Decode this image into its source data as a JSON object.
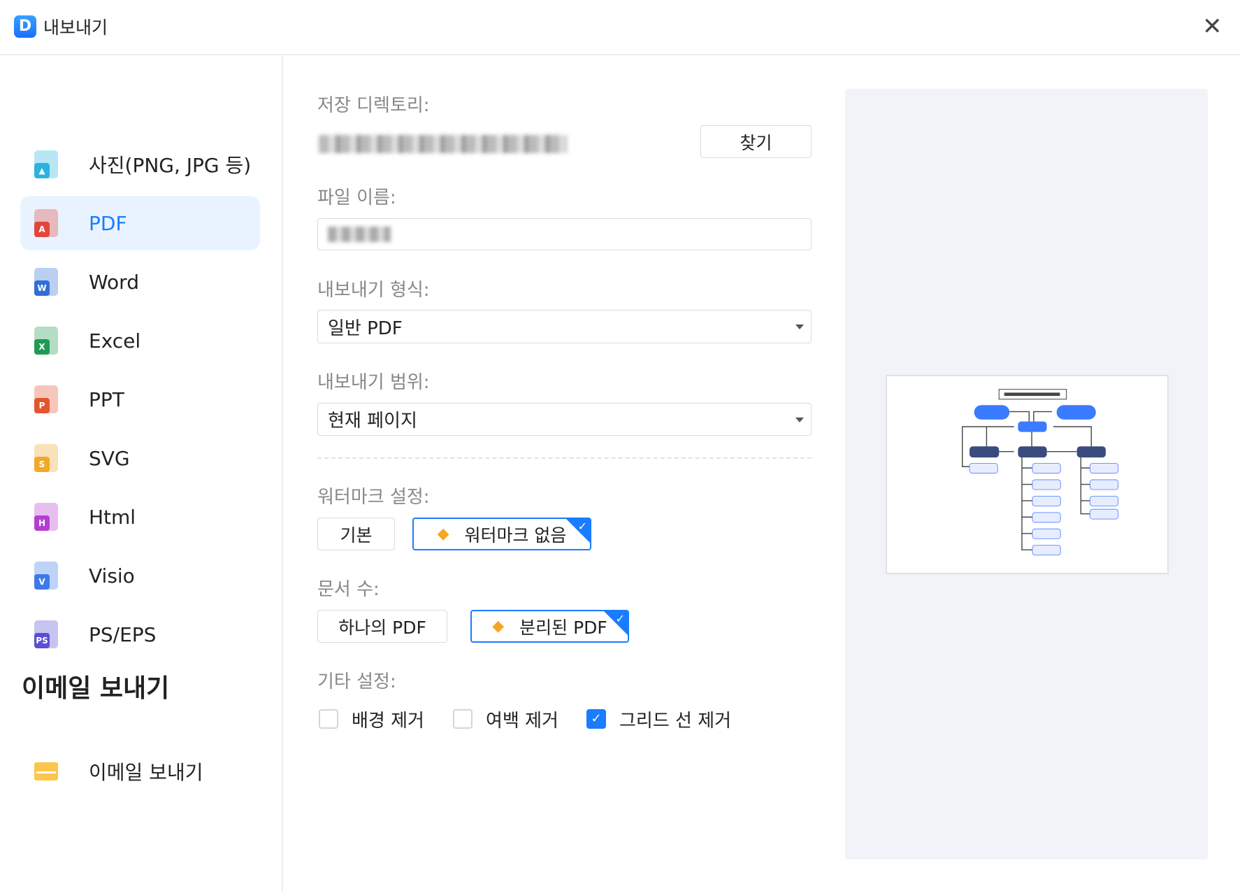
{
  "window": {
    "title": "내보내기",
    "logo_letter": "D"
  },
  "sidebar": {
    "items": [
      {
        "label": "사진(PNG, JPG 등)",
        "icon": "image-file-icon",
        "color": "#2bb3e0",
        "badge": "▲"
      },
      {
        "label": "PDF",
        "icon": "pdf-file-icon",
        "color": "#e2463a",
        "badge": "A",
        "selected": true
      },
      {
        "label": "Word",
        "icon": "word-file-icon",
        "color": "#2f6fd8",
        "badge": "W"
      },
      {
        "label": "Excel",
        "icon": "excel-file-icon",
        "color": "#1f9a52",
        "badge": "X"
      },
      {
        "label": "PPT",
        "icon": "ppt-file-icon",
        "color": "#e4552f",
        "badge": "P"
      },
      {
        "label": "SVG",
        "icon": "svg-file-icon",
        "color": "#f0a92a",
        "badge": "S"
      },
      {
        "label": "Html",
        "icon": "html-file-icon",
        "color": "#b33fd1",
        "badge": "H"
      },
      {
        "label": "Visio",
        "icon": "visio-file-icon",
        "color": "#3d7ae8",
        "badge": "V"
      },
      {
        "label": "PS/EPS",
        "icon": "pseps-file-icon",
        "color": "#5b4fd6",
        "badge": "PS"
      }
    ],
    "email_heading": "이메일 보내기",
    "email_item": "이메일 보내기"
  },
  "form": {
    "directory_label": "저장 디렉토리:",
    "browse_label": "찾기",
    "filename_label": "파일 이름:",
    "format_label": "내보내기 형식:",
    "format_value": "일반 PDF",
    "range_label": "내보내기 범위:",
    "range_value": "현재 페이지",
    "watermark_label": "워터마크 설정:",
    "watermark_options": [
      "기본",
      "워터마크 없음"
    ],
    "watermark_selected": "워터마크 없음",
    "doc_count_label": "문서 수:",
    "doc_count_options": [
      "하나의 PDF",
      "분리된 PDF"
    ],
    "doc_count_selected": "분리된 PDF",
    "other_label": "기타 설정:",
    "checkboxes": [
      {
        "label": "배경 제거",
        "checked": false
      },
      {
        "label": "여백 제거",
        "checked": false
      },
      {
        "label": "그리드 선 제거",
        "checked": true
      }
    ]
  },
  "colors": {
    "accent": "#1a7cff",
    "premium": "#f5a623"
  }
}
